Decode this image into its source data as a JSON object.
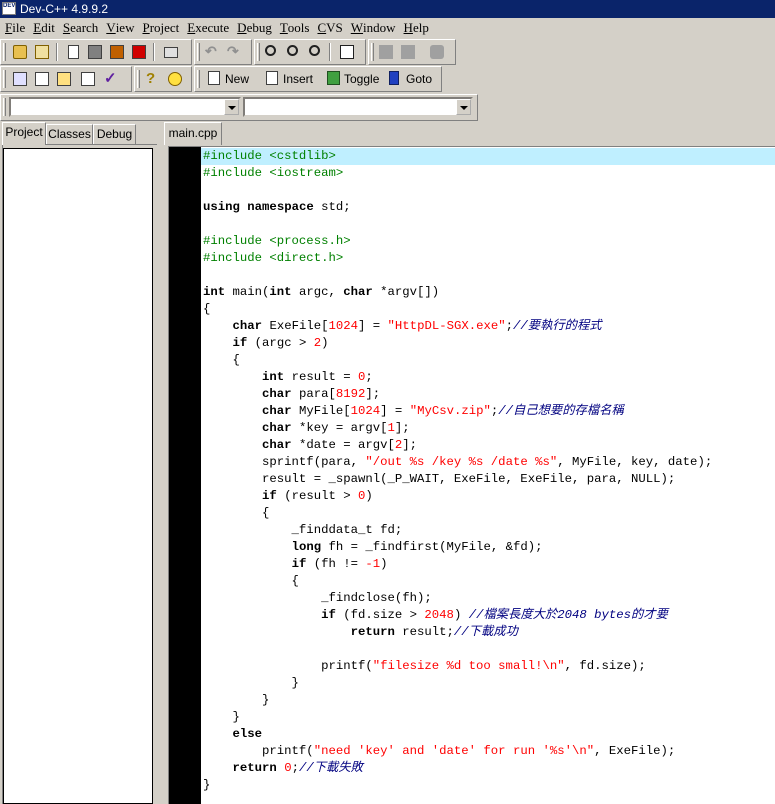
{
  "window": {
    "title": "Dev-C++ 4.9.9.2",
    "icon_text": "DEV"
  },
  "menu": [
    {
      "label": "File",
      "ul": "F",
      "rest": "ile"
    },
    {
      "label": "Edit",
      "ul": "E",
      "rest": "dit"
    },
    {
      "label": "Search",
      "ul": "S",
      "rest": "earch"
    },
    {
      "label": "View",
      "ul": "V",
      "rest": "iew"
    },
    {
      "label": "Project",
      "ul": "P",
      "rest": "roject"
    },
    {
      "label": "Execute",
      "ul": "E",
      "rest": "xecute"
    },
    {
      "label": "Debug",
      "ul": "D",
      "rest": "ebug"
    },
    {
      "label": "Tools",
      "ul": "T",
      "rest": "ools"
    },
    {
      "label": "CVS",
      "ul": "C",
      "rest": "VS"
    },
    {
      "label": "Window",
      "ul": "W",
      "rest": "indow"
    },
    {
      "label": "Help",
      "ul": "H",
      "rest": "elp"
    }
  ],
  "toolbar2": {
    "new_label": "New",
    "insert_label": "Insert",
    "toggle_label": "Toggle",
    "goto_label": "Goto"
  },
  "combos": {
    "class_value": "",
    "member_value": ""
  },
  "left_tabs": [
    {
      "label": "Project",
      "active": true
    },
    {
      "label": "Classes",
      "active": false
    },
    {
      "label": "Debug",
      "active": false
    }
  ],
  "editor_tab": "main.cpp",
  "colors": {
    "titlebar": "#0a246a",
    "current_line": "#bfefff",
    "preprocessor": "#008000",
    "string": "#ff0000",
    "comment": "#000080",
    "gutter": "#000000"
  },
  "code_lines": [
    [
      [
        "pp",
        "#include <cstdlib>"
      ]
    ],
    [
      [
        "pp",
        "#include <iostream>"
      ]
    ],
    [],
    [
      [
        "kw",
        "using"
      ],
      [
        "t",
        " "
      ],
      [
        "kw",
        "namespace"
      ],
      [
        "t",
        " std;"
      ]
    ],
    [],
    [
      [
        "pp",
        "#include <process.h>"
      ]
    ],
    [
      [
        "pp",
        "#include <direct.h>"
      ]
    ],
    [],
    [
      [
        "kw",
        "int"
      ],
      [
        "t",
        " main("
      ],
      [
        "kw",
        "int"
      ],
      [
        "t",
        " argc, "
      ],
      [
        "kw",
        "char"
      ],
      [
        "t",
        " *argv[])"
      ]
    ],
    [
      [
        "t",
        "{"
      ]
    ],
    [
      [
        "t",
        "    "
      ],
      [
        "kw",
        "char"
      ],
      [
        "t",
        " ExeFile["
      ],
      [
        "num",
        "1024"
      ],
      [
        "t",
        "] = "
      ],
      [
        "str",
        "\"HttpDL-SGX.exe\""
      ],
      [
        "t",
        ";"
      ],
      [
        "cm",
        "//要執行的程式"
      ]
    ],
    [
      [
        "t",
        "    "
      ],
      [
        "kw",
        "if"
      ],
      [
        "t",
        " (argc > "
      ],
      [
        "num",
        "2"
      ],
      [
        "t",
        ")"
      ]
    ],
    [
      [
        "t",
        "    {"
      ]
    ],
    [
      [
        "t",
        "        "
      ],
      [
        "kw",
        "int"
      ],
      [
        "t",
        " result = "
      ],
      [
        "num",
        "0"
      ],
      [
        "t",
        ";"
      ]
    ],
    [
      [
        "t",
        "        "
      ],
      [
        "kw",
        "char"
      ],
      [
        "t",
        " para["
      ],
      [
        "num",
        "8192"
      ],
      [
        "t",
        "];"
      ]
    ],
    [
      [
        "t",
        "        "
      ],
      [
        "kw",
        "char"
      ],
      [
        "t",
        " MyFile["
      ],
      [
        "num",
        "1024"
      ],
      [
        "t",
        "] = "
      ],
      [
        "str",
        "\"MyCsv.zip\""
      ],
      [
        "t",
        ";"
      ],
      [
        "cm",
        "//自己想要的存檔名稱"
      ]
    ],
    [
      [
        "t",
        "        "
      ],
      [
        "kw",
        "char"
      ],
      [
        "t",
        " *key = argv["
      ],
      [
        "num",
        "1"
      ],
      [
        "t",
        "];"
      ]
    ],
    [
      [
        "t",
        "        "
      ],
      [
        "kw",
        "char"
      ],
      [
        "t",
        " *date = argv["
      ],
      [
        "num",
        "2"
      ],
      [
        "t",
        "];"
      ]
    ],
    [
      [
        "t",
        "        sprintf(para, "
      ],
      [
        "str",
        "\"/out %s /key %s /date %s\""
      ],
      [
        "t",
        ", MyFile, key, date);"
      ]
    ],
    [
      [
        "t",
        "        result = _spawnl(_P_WAIT, ExeFile, ExeFile, para, NULL);"
      ]
    ],
    [
      [
        "t",
        "        "
      ],
      [
        "kw",
        "if"
      ],
      [
        "t",
        " (result > "
      ],
      [
        "num",
        "0"
      ],
      [
        "t",
        ")"
      ]
    ],
    [
      [
        "t",
        "        {"
      ]
    ],
    [
      [
        "t",
        "            _finddata_t fd;"
      ]
    ],
    [
      [
        "t",
        "            "
      ],
      [
        "kw",
        "long"
      ],
      [
        "t",
        " fh = _findfirst(MyFile, &fd);"
      ]
    ],
    [
      [
        "t",
        "            "
      ],
      [
        "kw",
        "if"
      ],
      [
        "t",
        " (fh != "
      ],
      [
        "num",
        "-1"
      ],
      [
        "t",
        ")"
      ]
    ],
    [
      [
        "t",
        "            {"
      ]
    ],
    [
      [
        "t",
        "                _findclose(fh);"
      ]
    ],
    [
      [
        "t",
        "                "
      ],
      [
        "kw",
        "if"
      ],
      [
        "t",
        " (fd.size > "
      ],
      [
        "num",
        "2048"
      ],
      [
        "t",
        ") "
      ],
      [
        "cm",
        "//檔案長度大於2048 bytes的才要"
      ]
    ],
    [
      [
        "t",
        "                    "
      ],
      [
        "kw",
        "return"
      ],
      [
        "t",
        " result;"
      ],
      [
        "cm",
        "//下載成功"
      ]
    ],
    [],
    [
      [
        "t",
        "                printf("
      ],
      [
        "str",
        "\"filesize %d too small!\\n\""
      ],
      [
        "t",
        ", fd.size);"
      ]
    ],
    [
      [
        "t",
        "            }"
      ]
    ],
    [
      [
        "t",
        "        }"
      ]
    ],
    [
      [
        "t",
        "    }"
      ]
    ],
    [
      [
        "t",
        "    "
      ],
      [
        "kw",
        "else"
      ]
    ],
    [
      [
        "t",
        "        printf("
      ],
      [
        "str",
        "\"need 'key' and 'date' for run '%s'\\n\""
      ],
      [
        "t",
        ", ExeFile);"
      ]
    ],
    [
      [
        "t",
        "    "
      ],
      [
        "kw",
        "return"
      ],
      [
        "t",
        " "
      ],
      [
        "num",
        "0"
      ],
      [
        "t",
        ";"
      ],
      [
        "cm",
        "//下載失敗"
      ]
    ],
    [
      [
        "t",
        "}"
      ]
    ]
  ]
}
